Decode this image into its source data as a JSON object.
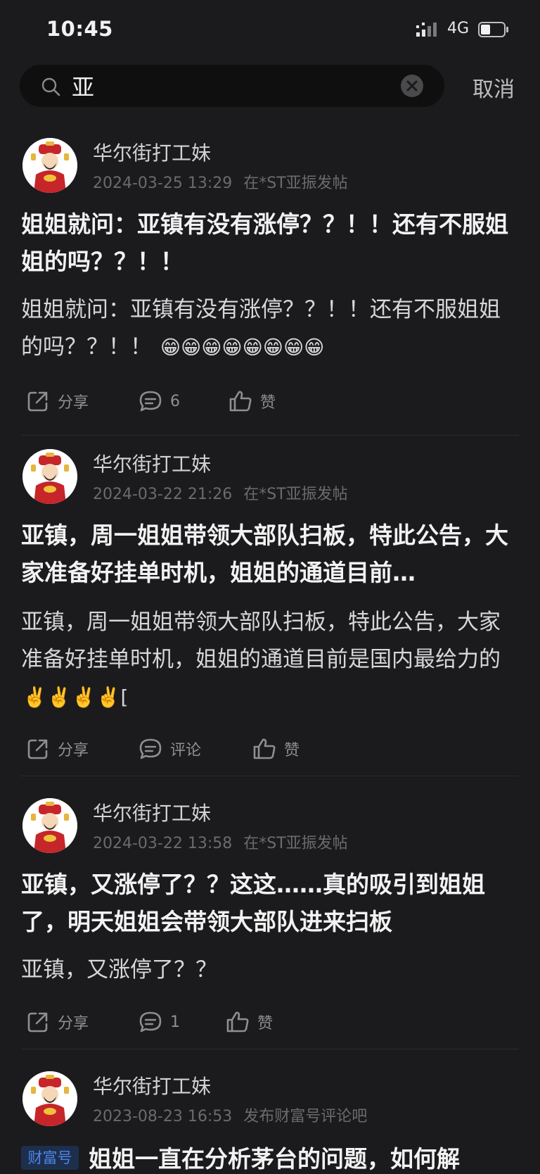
{
  "status_bar": {
    "time": "10:45",
    "network": "4G"
  },
  "search": {
    "value": "亚",
    "cancel_label": "取消"
  },
  "posts": [
    {
      "author": "华尔街打工妹",
      "datetime": "2024-03-25 13:29",
      "source": "在*ST亚振发帖",
      "title": "姐姐就问：亚镇有没有涨停？？！！还有不服姐姐的吗？？！！",
      "body": "姐姐就问：亚镇有没有涨停？？！！还有不服姐姐的吗？？！！",
      "emoji": "😁😁😁😁😁😁😁😁",
      "share_label": "分享",
      "comment_label": "6",
      "like_label": "赞"
    },
    {
      "author": "华尔街打工妹",
      "datetime": "2024-03-22 21:26",
      "source": "在*ST亚振发帖",
      "title": "亚镇，周一姐姐带领大部队扫板，特此公告，大家准备好挂单时机，姐姐的通道目前…",
      "body": "亚镇，周一姐姐带领大部队扫板，特此公告，大家准备好挂单时机，姐姐的通道目前是国内最给力的",
      "emoji": "✌️✌️✌️✌️[",
      "share_label": "分享",
      "comment_label": "评论",
      "like_label": "赞"
    },
    {
      "author": "华尔街打工妹",
      "datetime": "2024-03-22 13:58",
      "source": "在*ST亚振发帖",
      "title": "亚镇，又涨停了？？这这……真的吸引到姐姐了，明天姐姐会带领大部队进来扫板",
      "body": "亚镇，又涨停了？？",
      "emoji": "",
      "share_label": "分享",
      "comment_label": "1",
      "like_label": "赞"
    },
    {
      "author": "华尔街打工妹",
      "datetime": "2023-08-23 16:53",
      "source": "发布财富号评论吧",
      "badge": "财富号",
      "title": "姐姐一直在分析茅台的问题，如何解"
    }
  ],
  "colors": {
    "background": "#1b1b1d",
    "badge_text": "#4a86e8",
    "muted": "#6b6b6e"
  },
  "icons": [
    "search-icon",
    "clear-icon",
    "share-icon",
    "comment-icon",
    "like-icon",
    "avatar-caishen"
  ]
}
